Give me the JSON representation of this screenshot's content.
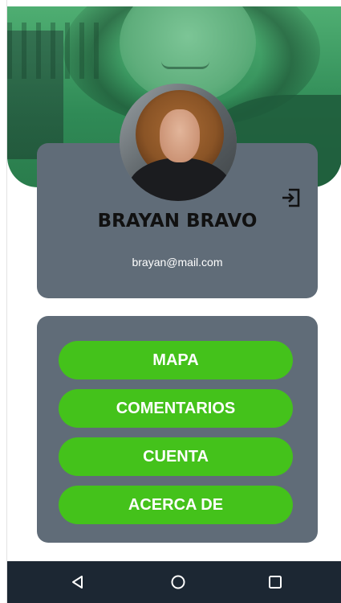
{
  "profile": {
    "name": "BRAYAN BRAVO",
    "email": "brayan@mail.com"
  },
  "menu": {
    "items": [
      {
        "label": "MAPA"
      },
      {
        "label": "COMENTARIOS"
      },
      {
        "label": "CUENTA"
      },
      {
        "label": "ACERCA DE"
      }
    ]
  },
  "icons": {
    "logout": "logout-icon",
    "back": "back-triangle-icon",
    "home": "home-circle-icon",
    "recents": "recents-square-icon"
  },
  "colors": {
    "card": "#606c78",
    "button": "#44c21b",
    "navbar": "#1c2733",
    "banner_tint": "#3a9a62"
  }
}
